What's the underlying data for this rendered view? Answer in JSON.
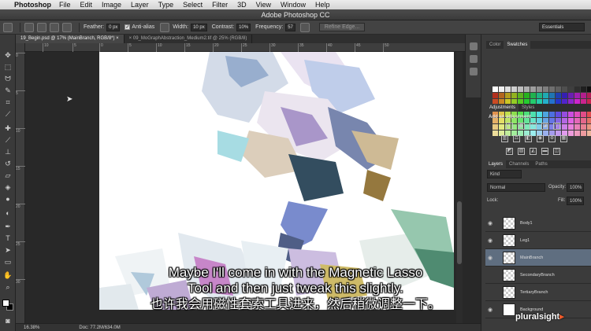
{
  "menubar": {
    "app_name": "Photoshop",
    "items": [
      "File",
      "Edit",
      "Image",
      "Layer",
      "Type",
      "Select",
      "Filter",
      "3D",
      "View",
      "Window",
      "Help"
    ]
  },
  "window_title": "Adobe Photoshop CC",
  "options": {
    "feather_label": "Feather:",
    "feather_value": "0 px",
    "antialias_label": "Anti-alias",
    "width_label": "Width:",
    "width_value": "10 px",
    "contrast_label": "Contrast:",
    "contrast_value": "10%",
    "frequency_label": "Frequency:",
    "frequency_value": "57",
    "refine_edge": "Refine Edge...",
    "workspace": "Essentials"
  },
  "tabs": [
    {
      "label": "19_Begin.psd @ 17% (MainBranch, RGB/8*)"
    },
    {
      "label": "09_MoGraphAbstraction_Medium2.tif @ 25% (RGB/8)"
    }
  ],
  "ruler": {
    "top_ticks": [
      "10",
      "5",
      "0",
      "5",
      "10",
      "15",
      "20",
      "25",
      "30",
      "35",
      "40",
      "45",
      "50"
    ],
    "left_ticks": [
      "0",
      "5",
      "10",
      "15",
      "20",
      "25",
      "30"
    ]
  },
  "status": {
    "zoom": "16.38%",
    "doc": "Doc: 77.2M/634.0M"
  },
  "panels": {
    "color_tab": "Color",
    "swatches_tab": "Swatches",
    "adjustments_tab": "Adjustments",
    "styles_tab": "Styles",
    "add_adjustment": "Add an adjustment",
    "layers_tab": "Layers",
    "channels_tab": "Channels",
    "paths_tab": "Paths",
    "kind": "Kind",
    "blend_mode": "Normal",
    "opacity_label": "Opacity:",
    "opacity_value": "100%",
    "lock_label": "Lock:",
    "fill_label": "Fill:",
    "fill_value": "100%"
  },
  "layers": [
    "Body1",
    "Leg1",
    "MainBranch",
    "SecondaryBranch",
    "TertiaryBranch",
    "Background"
  ],
  "selected_layer": "MainBranch",
  "subtitles": {
    "en_line1": "Maybe I'll come in with the Magnetic Lasso",
    "en_line2": "Tool and then just tweak this slightly.",
    "zh": "也许我会用磁性套索工具进来，然后稍微调整一下。"
  },
  "watermark": "pluralsight",
  "colors": {
    "accent_selection": "#5f6e80",
    "ui_dark": "#3b3b3b",
    "logo_dot": "#f15b2a"
  }
}
